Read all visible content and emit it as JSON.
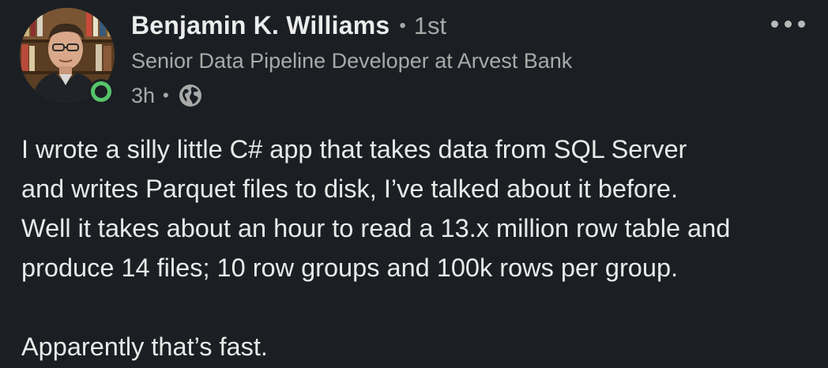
{
  "post": {
    "author": {
      "name": "Benjamin K. Williams",
      "degree": "1st",
      "headline": "Senior Data Pipeline Developer at Arvest Bank",
      "presence": "online",
      "presence_color": "#57c46a"
    },
    "meta": {
      "time": "3h",
      "visibility_icon": "globe-icon"
    },
    "more_icon": "more-horizontal-icon",
    "body": {
      "lines": [
        "I wrote a silly little C# app that takes data from SQL Server",
        "and writes Parquet files to disk, I’ve talked about it before.",
        "Well it takes about an hour to read a 13.x million row table and",
        "produce 14 files; 10 row groups and 100k rows per group."
      ],
      "closing": "Apparently that’s fast."
    }
  }
}
